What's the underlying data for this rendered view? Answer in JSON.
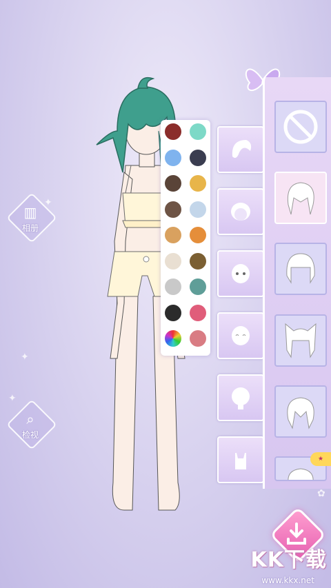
{
  "side_buttons": {
    "album_label": "相册",
    "inspect_label": "检视"
  },
  "palette": {
    "colors": [
      "#8b2d2b",
      "#7dd9c7",
      "#7fb3ee",
      "#3a3d50",
      "#5a4438",
      "#e8b54a",
      "#6e5445",
      "#c3d6ea",
      "#d9a15f",
      "#e58e3a",
      "#e9dfd2",
      "#7b5f32",
      "#c9c9c9",
      "#5f9e98",
      "#2b2b2b",
      "#e05d7a",
      "rainbow",
      "#d97c83"
    ]
  },
  "category_tabs": [
    {
      "name": "hair"
    },
    {
      "name": "head"
    },
    {
      "name": "face"
    },
    {
      "name": "expression"
    },
    {
      "name": "body"
    },
    {
      "name": "top"
    }
  ],
  "item_panel": {
    "items": [
      {
        "name": "none",
        "selected": false
      },
      {
        "name": "spiky-hair",
        "selected": true
      },
      {
        "name": "bob-hair",
        "selected": false
      },
      {
        "name": "cat-ear-hair",
        "selected": false
      },
      {
        "name": "messy-hair",
        "selected": false
      }
    ]
  },
  "watermark": {
    "text": "KK下载",
    "url": "www.kkx.net"
  }
}
